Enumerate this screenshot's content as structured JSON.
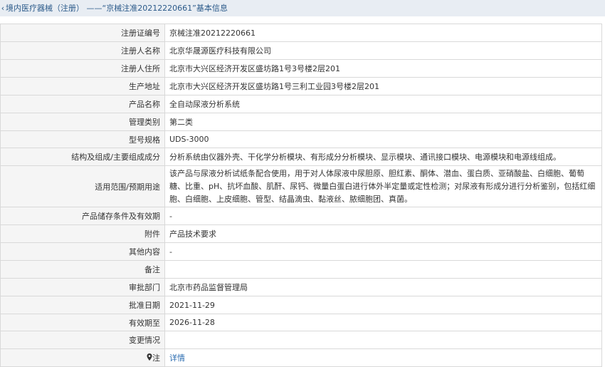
{
  "header": {
    "back_icon": "‹",
    "title": "境内医疗器械（注册） ——“京械注准20212220661”基本信息"
  },
  "rows": [
    {
      "label": "注册证编号",
      "value": "京械注准20212220661"
    },
    {
      "label": "注册人名称",
      "value": "北京华晟源医疗科技有限公司"
    },
    {
      "label": "注册人住所",
      "value": "北京市大兴区经济开发区盛坊路1号3号楼2层201"
    },
    {
      "label": "生产地址",
      "value": "北京市大兴区经济开发区盛坊路1号三利工业园3号楼2层201"
    },
    {
      "label": "产品名称",
      "value": "全自动尿液分析系统"
    },
    {
      "label": "管理类别",
      "value": "第二类"
    },
    {
      "label": "型号规格",
      "value": "UDS-3000"
    },
    {
      "label": "结构及组成/主要组成成分",
      "value": "分析系统由仪器外壳、干化学分析模块、有形成分分析模块、显示模块、通讯接口模块、电源模块和电源线组成。"
    },
    {
      "label": "适用范围/预期用途",
      "value": "该产品与尿液分析试纸条配合使用，用于对人体尿液中尿胆原、胆红素、酮体、潜血、蛋白质、亚硝酸盐、白细胞、葡萄糖、比重、pH、抗坏血酸、肌酐、尿钙、微量白蛋白进行体外半定量或定性检测；对尿液有形成分进行分析鉴别，包括红细胞、白细胞、上皮细胞、管型、结晶滴虫、黏液丝、脓细胞团、真菌。"
    },
    {
      "label": "产品储存条件及有效期",
      "value": "-"
    },
    {
      "label": "附件",
      "value": "产品技术要求"
    },
    {
      "label": "其他内容",
      "value": "-"
    },
    {
      "label": "备注",
      "value": ""
    },
    {
      "label": "审批部门",
      "value": "北京市药品监督管理局"
    },
    {
      "label": "批准日期",
      "value": "2021-11-29"
    },
    {
      "label": "有效期至",
      "value": "2026-11-28"
    },
    {
      "label": "变更情况",
      "value": ""
    }
  ],
  "note_row": {
    "icon": "map-pin-icon",
    "label": "注",
    "link_text": "详情"
  }
}
